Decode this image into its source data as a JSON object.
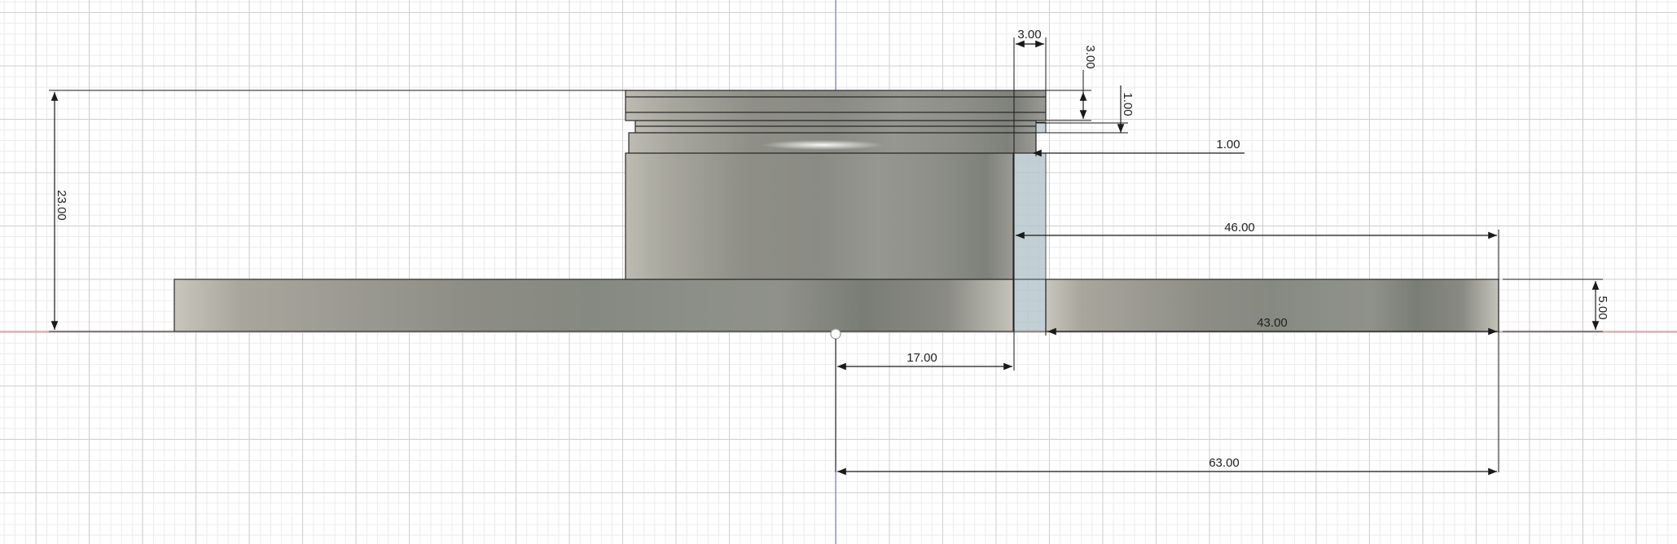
{
  "app": {
    "view": "Front orthographic sketch view",
    "colors": {
      "background": "#ffffff",
      "grid_major": "#d0d0d0",
      "grid_minor": "#ececec",
      "x_axis": "#f08080",
      "y_axis": "#8080e0",
      "model_face": "#9a9a92",
      "selected_face": "#aebfc6",
      "dimension": "#1a1a1a"
    }
  },
  "dimensions": {
    "overall_height": "23.00",
    "lid_width": "3.00",
    "lid_height": "3.00",
    "step_height": "1.00",
    "step_offset": "1.00",
    "flange_extent": "46.00",
    "flange_remaining": "43.00",
    "base_thickness": "5.00",
    "inner_radius": "17.00",
    "outer_radius": "63.00"
  }
}
